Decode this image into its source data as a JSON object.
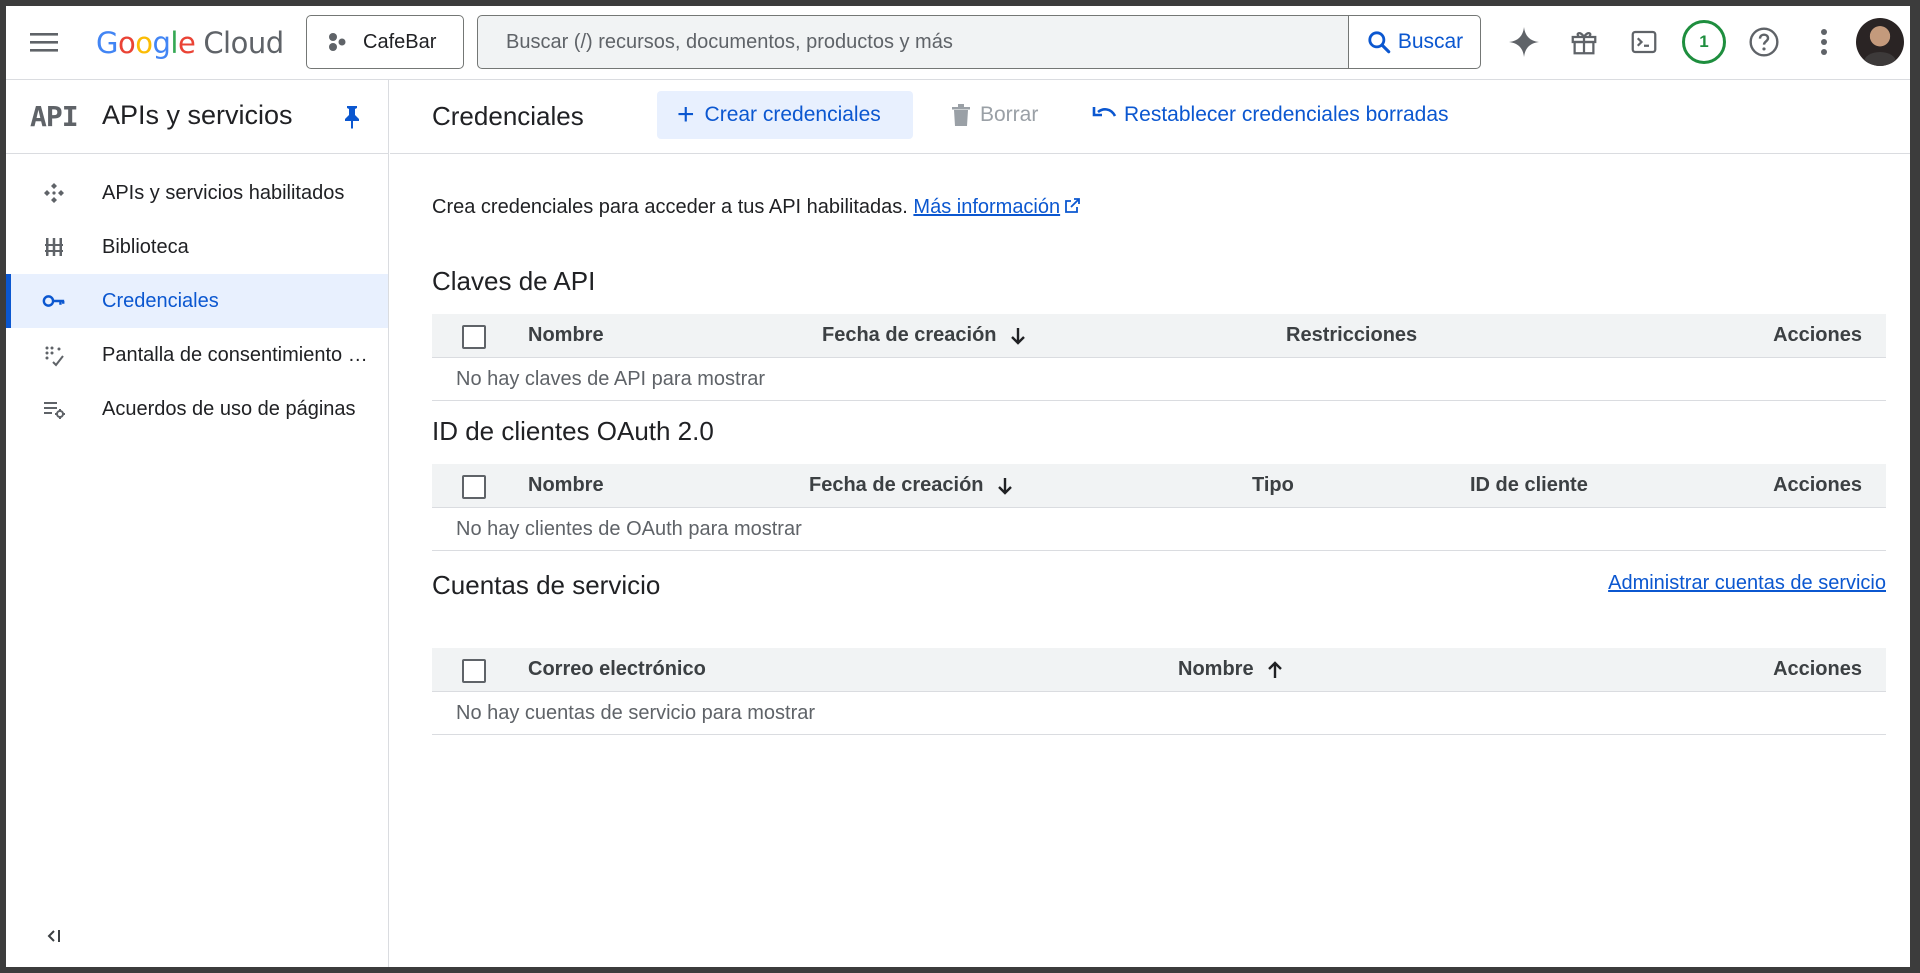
{
  "header": {
    "logo_word": "Google",
    "logo_cloud": "Cloud",
    "project": "CafeBar",
    "search_placeholder": "Buscar (/) recursos, documentos, productos y más",
    "search_button": "Buscar",
    "notifications_count": "1"
  },
  "sidebar": {
    "logo": "API",
    "title": "APIs y servicios",
    "items": [
      {
        "label": "APIs y servicios habilitados",
        "icon": "apis-services-icon"
      },
      {
        "label": "Biblioteca",
        "icon": "library-icon"
      },
      {
        "label": "Credenciales",
        "icon": "key-icon",
        "active": true
      },
      {
        "label": "Pantalla de consentimiento de OAuth",
        "icon": "consent-screen-icon"
      },
      {
        "label": "Acuerdos de uso de páginas",
        "icon": "page-usage-agreements-icon"
      }
    ]
  },
  "main": {
    "title": "Credenciales",
    "create_label": "Crear credenciales",
    "delete_label": "Borrar",
    "restore_label": "Restablecer credenciales borradas",
    "intro_text": "Crea credenciales para acceder a tus API habilitadas.",
    "intro_link": "Más información",
    "api_keys": {
      "title": "Claves de API",
      "columns": [
        "Nombre",
        "Fecha de creación",
        "Restricciones",
        "Acciones"
      ],
      "empty": "No hay claves de API para mostrar"
    },
    "oauth": {
      "title": "ID de clientes OAuth 2.0",
      "columns": [
        "Nombre",
        "Fecha de creación",
        "Tipo",
        "ID de cliente",
        "Acciones"
      ],
      "empty": "No hay clientes de OAuth para mostrar"
    },
    "service_accounts": {
      "title": "Cuentas de servicio",
      "manage_link": "Administrar cuentas de servicio",
      "columns": [
        "Correo electrónico",
        "Nombre",
        "Acciones"
      ],
      "empty": "No hay cuentas de servicio para mostrar"
    }
  },
  "colors": {
    "accent": "#0b57d0",
    "active_bg": "#e8f0fe",
    "badge": "#1e8e3e"
  }
}
